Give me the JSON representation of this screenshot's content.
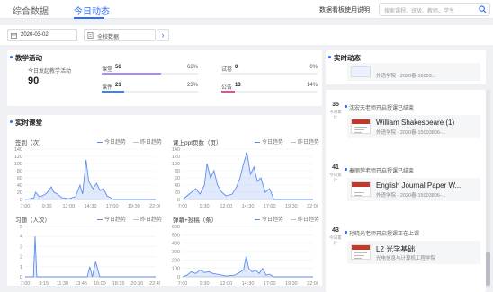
{
  "header": {
    "tabs": [
      {
        "label": "综合数据"
      },
      {
        "label": "今日动态"
      }
    ],
    "guide_link": "数据看板使用说明",
    "search_placeholder": "搜索课程、班级、教师、学生"
  },
  "filters": {
    "date": "2020-03-02",
    "range": "全校数据"
  },
  "teaching": {
    "title": "教学活动",
    "today_label": "今日发起教学活动",
    "today_value": "90",
    "metrics": [
      {
        "name": "课堂",
        "value": "56",
        "pct": "62%",
        "ratio": 0.62,
        "color": "#a78bfa"
      },
      {
        "name": "试卷",
        "value": "0",
        "pct": "0%",
        "ratio": 0,
        "color": "#f59e0b"
      },
      {
        "name": "课件",
        "value": "21",
        "pct": "23%",
        "ratio": 0.23,
        "color": "#3b82f6"
      },
      {
        "name": "公告",
        "value": "13",
        "pct": "14%",
        "ratio": 0.14,
        "color": "#ec4899"
      }
    ]
  },
  "realtime": {
    "title": "实时课堂",
    "legend_today": "今日趋势",
    "legend_yesterday": "昨日趋势"
  },
  "chart_data": [
    {
      "type": "area",
      "title": "签到（次）",
      "x_ticks": [
        "7:00",
        "9:30",
        "12:00",
        "14:30",
        "17:00",
        "19:30",
        "22:00"
      ],
      "y_ticks": [
        "0",
        "20",
        "40",
        "60",
        "80",
        "100",
        "120",
        "140"
      ],
      "ylim": [
        0,
        140
      ],
      "series": [
        {
          "name": "今日趋势",
          "color": "#5b8def",
          "x": [
            7.0,
            7.5,
            8.0,
            8.2,
            8.6,
            9.0,
            9.5,
            10.0,
            10.3,
            10.7,
            11.2,
            12.0,
            12.8,
            13.3,
            13.6,
            14.0,
            14.3,
            14.8,
            15.2,
            15.6,
            16.0,
            16.4,
            16.8,
            17.2,
            19.0,
            22.0
          ],
          "y": [
            0,
            2,
            5,
            20,
            8,
            10,
            18,
            35,
            20,
            15,
            5,
            2,
            8,
            40,
            15,
            110,
            50,
            30,
            45,
            25,
            30,
            10,
            5,
            0,
            0,
            0
          ]
        },
        {
          "name": "昨日趋势",
          "color": "#b8c4d6",
          "x": [
            7.0,
            22.0
          ],
          "y": [
            0,
            0
          ]
        }
      ]
    },
    {
      "type": "area",
      "title": "课上ppt页数（页）",
      "x_ticks": [
        "7:00",
        "9:30",
        "12:00",
        "14:30",
        "17:00",
        "19:30",
        "22:00"
      ],
      "y_ticks": [
        "0",
        "20",
        "40",
        "60",
        "80",
        "100",
        "120",
        "140"
      ],
      "ylim": [
        0,
        140
      ],
      "series": [
        {
          "name": "今日趋势",
          "color": "#5b8def",
          "x": [
            7.0,
            7.5,
            8.0,
            8.5,
            9.0,
            9.5,
            9.8,
            10.2,
            10.6,
            11.0,
            11.5,
            12.0,
            12.7,
            13.2,
            13.6,
            14.0,
            14.4,
            14.8,
            15.2,
            15.6,
            16.0,
            16.5,
            17.0,
            17.5,
            22.0
          ],
          "y": [
            0,
            10,
            20,
            30,
            15,
            40,
            100,
            60,
            80,
            40,
            20,
            10,
            15,
            35,
            60,
            100,
            130,
            70,
            90,
            50,
            60,
            20,
            30,
            0,
            0
          ]
        },
        {
          "name": "昨日趋势",
          "color": "#b8c4d6",
          "x": [
            7.0,
            22.0
          ],
          "y": [
            0,
            0
          ]
        }
      ]
    },
    {
      "type": "area",
      "title": "习题（人次）",
      "x_ticks": [
        "7:00",
        "9:15",
        "11:30",
        "13:45",
        "16:00",
        "18:15",
        "20:30",
        "22:45"
      ],
      "y_ticks": [
        "0",
        "1",
        "2",
        "3",
        "4",
        "5"
      ],
      "ylim": [
        0,
        5
      ],
      "series": [
        {
          "name": "今日趋势",
          "color": "#5b8def",
          "x": [
            7.0,
            8.0,
            8.2,
            8.4,
            9.5,
            13.0,
            14.5,
            14.8,
            15.1,
            15.5,
            16.0,
            17.0,
            22.75
          ],
          "y": [
            0,
            0,
            4,
            0,
            0,
            0,
            0,
            1,
            0,
            1.5,
            0,
            0,
            0
          ]
        },
        {
          "name": "昨日趋势",
          "color": "#b8c4d6",
          "x": [
            7.0,
            22.75
          ],
          "y": [
            0,
            0
          ]
        }
      ]
    },
    {
      "type": "area",
      "title": "弹幕+投稿（条）",
      "x_ticks": [
        "7:00",
        "9:30",
        "12:00",
        "14:30",
        "17:00",
        "19:30",
        "22:00"
      ],
      "y_ticks": [
        "0",
        "100",
        "200",
        "300",
        "400",
        "500",
        "600"
      ],
      "ylim": [
        0,
        600
      ],
      "series": [
        {
          "name": "今日趋势",
          "color": "#5b8def",
          "x": [
            7.0,
            7.5,
            8.0,
            8.5,
            9.0,
            9.5,
            10.0,
            10.5,
            11.0,
            11.5,
            12.0,
            13.0,
            13.5,
            14.0,
            14.3,
            14.6,
            15.0,
            15.4,
            15.8,
            16.2,
            16.6,
            17.0,
            17.5,
            22.0
          ],
          "y": [
            0,
            20,
            60,
            40,
            80,
            50,
            60,
            40,
            30,
            20,
            10,
            20,
            50,
            80,
            250,
            100,
            60,
            80,
            40,
            100,
            20,
            30,
            0,
            0
          ]
        },
        {
          "name": "昨日趋势",
          "color": "#b8c4d6",
          "x": [
            7.0,
            22.0
          ],
          "y": [
            0,
            0
          ]
        }
      ]
    }
  ],
  "feed": {
    "title": "实时动态",
    "count_caption": "今日累计",
    "items": [
      {
        "count": "",
        "text": "",
        "course": "",
        "meta": "外语学院 · 2020春-15003..."
      },
      {
        "count": "35",
        "text": "沈宏天老师开启授课已结束",
        "course": "William Shakespeare (1)",
        "meta": "外语学院 · 2020春-15003806-..."
      },
      {
        "count": "41",
        "text": "秦丽萍老师开启授课已结束",
        "course": "English Journal Paper W...",
        "meta": "外语学院 · 2020春-15003806-..."
      },
      {
        "count": "43",
        "text": "孙晓光老师开启授课正在上课",
        "course": "L2 光学基础",
        "meta": "光电信息与计算机工程学院"
      }
    ]
  }
}
